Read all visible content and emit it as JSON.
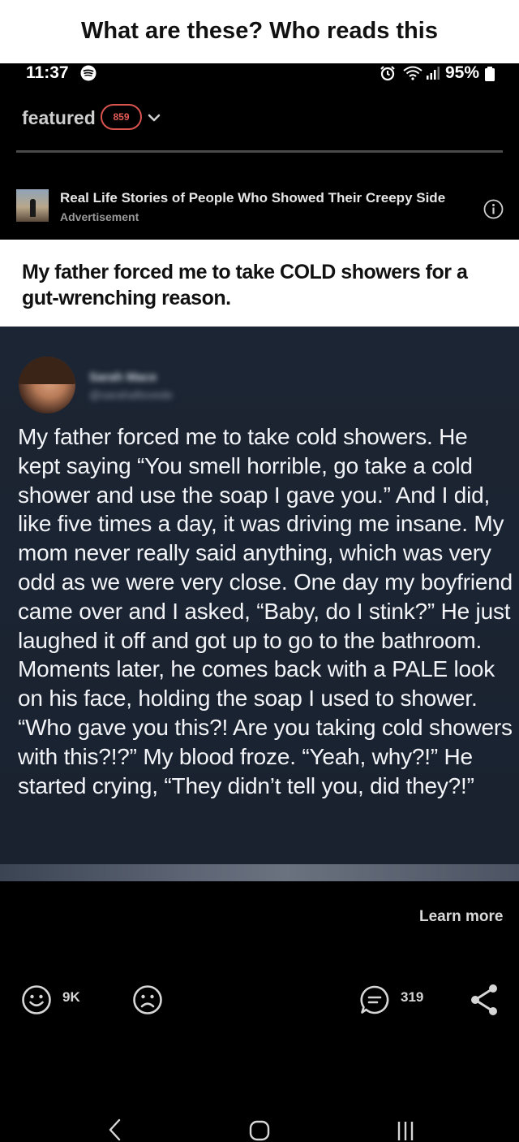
{
  "caption": "What are these? Who reads this",
  "status_bar": {
    "time": "11:37",
    "battery": "95%",
    "icons": [
      "spotify-icon",
      "alarm-icon",
      "wifi-icon",
      "signal-icon",
      "battery-icon"
    ]
  },
  "header": {
    "tab_label": "featured",
    "badge_count": "859",
    "dropdown_icon": "chevron-down-icon"
  },
  "ad": {
    "title": "Real Life Stories of People Who Showed Their Creepy Side",
    "label": "Advertisement",
    "info_icon": "info-icon"
  },
  "headline": "My father forced me to take COLD showers for a gut-wrenching reason.",
  "story": {
    "author_name": "Sarah Mace",
    "author_handle": "@sarahaftovede",
    "text": "My father forced me to take cold showers. He kept saying “You smell horrible, go take a cold shower and use the soap I gave you.” And I did, like five times a day, it was driving me insane. My mom never really said anything, which was very odd as we were very close. One day my boyfriend came over and I asked, “Baby, do I stink?” He just laughed it off and got up to go to the bathroom. Moments later, he comes back with a PALE look on his face, holding the soap I used to shower. “Who gave you this?! Are you taking cold showers with this?!?” My blood froze. “Yeah, why?!” He started crying, “They didn’t tell you, did they?!”"
  },
  "cta": "Learn more",
  "actions": {
    "smile_count": "9K",
    "comment_count": "319",
    "icons": [
      "smile-icon",
      "frown-icon",
      "comment-icon",
      "share-icon"
    ]
  },
  "system_nav": [
    "back-icon",
    "home-icon",
    "recents-icon"
  ],
  "colors": {
    "background": "#000000",
    "card": "#1c2533",
    "badge": "#d9534f",
    "text_light": "#f2f4f7"
  }
}
